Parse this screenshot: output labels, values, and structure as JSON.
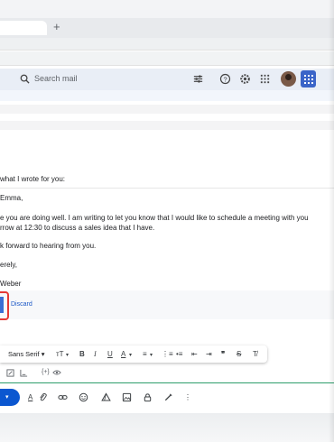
{
  "browser": {
    "new_tab_glyph": "+"
  },
  "header": {
    "search_placeholder": "Search mail",
    "icons": [
      "search-icon",
      "filter-icon",
      "help-icon",
      "settings-icon",
      "apps-grid-icon",
      "avatar",
      "apps-tile-icon"
    ]
  },
  "message": {
    "intro": "what I wrote for you:",
    "greeting": "Emma,",
    "line1": "e you are doing well. I am writing to let you know that I would like to schedule a meeting with you",
    "line2": "rrow at 12:30 to discuss a sales idea that I have.",
    "closing_line": "k forward to hearing from you.",
    "signoff": "erely,",
    "signature": "Weber"
  },
  "suggestion": {
    "discard_label": "Discard"
  },
  "format_toolbar": {
    "font": "Sans Serif",
    "font_caret": "▾",
    "size_label": "тT",
    "bold": "B",
    "italic": "I",
    "underline": "U",
    "text_color": "A",
    "caret": "▾",
    "align": "≡",
    "numbered_list": "⋮≡",
    "bulleted_list": "•≡",
    "indent_less": "⇤",
    "indent_more": "⇥",
    "quote": "❞",
    "strikethrough": "S",
    "clear_format": "T̸"
  },
  "row2": {
    "variables": "{+}",
    "preview_icon": "eye-icon"
  },
  "bottom_toolbar": {
    "send_caret": "▾",
    "format_label": "A",
    "more": "⋮"
  },
  "colors": {
    "accent": "#0b57d0",
    "highlight_border": "#e53935",
    "link": "#1a57c6",
    "header_bg": "#e9eef6"
  }
}
